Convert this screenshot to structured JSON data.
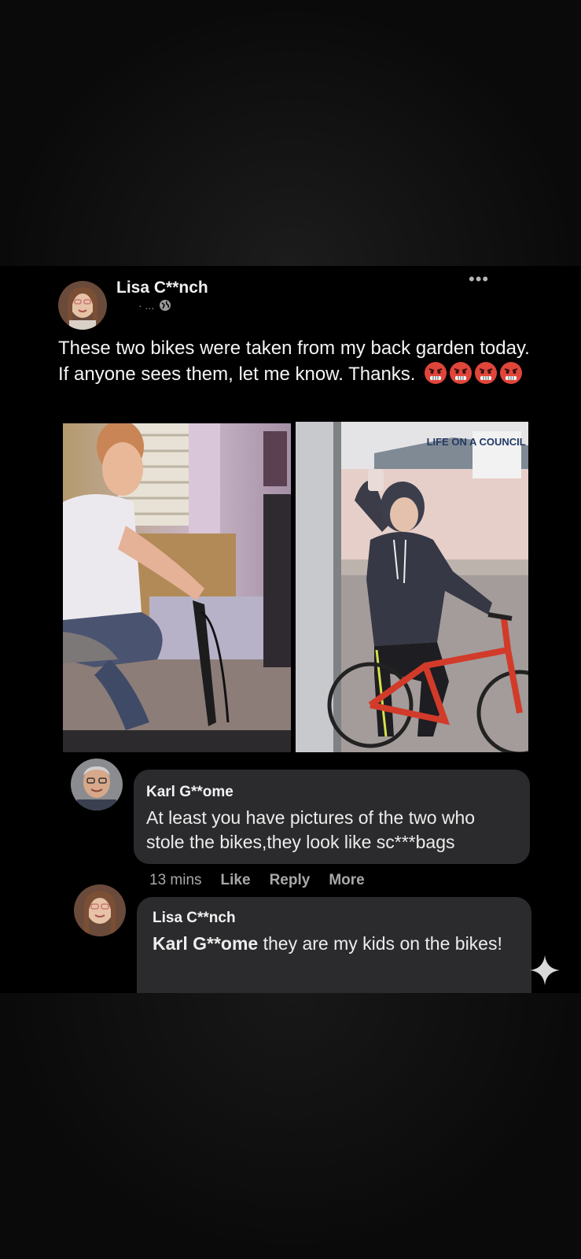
{
  "post": {
    "author": "Lisa C**nch",
    "meta": "· ...",
    "text": "These two bikes were taken from my back garden today. If anyone sees them, let me know. Thanks.",
    "emoji_icon": "angry-face",
    "watermark": "LIFE ON A COUNCIL ESTATE"
  },
  "comments": [
    {
      "author": "Karl G**ome",
      "text": "At least you have pictures of the two who stole the bikes,they look like sc***bags",
      "time": "13 mins",
      "actions": [
        "Like",
        "Reply",
        "More"
      ]
    },
    {
      "author": "Lisa C**nch",
      "mention": "Karl G**ome",
      "text": " they are my kids on the bikes!"
    }
  ],
  "colors": {
    "bubble": "#2b2b2d",
    "page": "#000000"
  }
}
